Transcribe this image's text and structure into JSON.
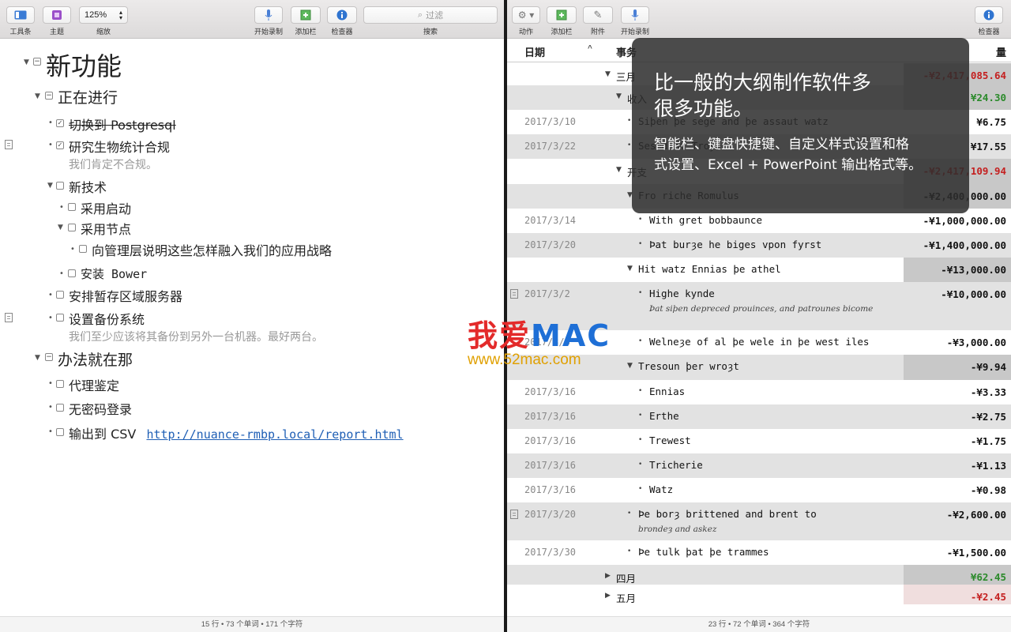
{
  "left_toolbar": {
    "sidebar_label": "工具条",
    "theme_label": "主题",
    "zoom_value": "125%",
    "zoom_label": "缩放",
    "record_label": "开始录制",
    "add_column_label": "添加栏",
    "inspector_label": "检查器",
    "search_placeholder": "过滤",
    "search_label": "搜索"
  },
  "right_toolbar": {
    "action_label": "动作",
    "add_column_label": "添加栏",
    "attachment_label": "附件",
    "record_label": "开始录制",
    "inspector_label": "检查器"
  },
  "outline": {
    "title": "新功能",
    "section1": "正在进行",
    "item1": "切换到 Postgresql",
    "item2": "研究生物统计合规",
    "item2_note": "我们肯定不合规。",
    "item3": "新技术",
    "item3a": "采用启动",
    "item3b": "采用节点",
    "item3b1": "向管理层说明这些怎样融入我们的应用战略",
    "item3c": "安装 Bower",
    "item4": "安排暂存区域服务器",
    "item5": "设置备份系统",
    "item5_note": "我们至少应该将其备份到另外一台机器。最好两台。",
    "section2": "办法就在那",
    "item6": "代理鉴定",
    "item7": "无密码登录",
    "item8_text": "输出到 CSV",
    "item8_link": "http://nuance-rmbp.local/report.html"
  },
  "left_status": "15 行 • 73 个单词 • 171 个字符",
  "table": {
    "col_date": "日期",
    "col_event": "事务",
    "col_amount": "量",
    "rows": [
      {
        "date": "",
        "event": "三月",
        "amount": "-¥2,417,085.64"
      },
      {
        "date": "",
        "event": "收入",
        "amount": "¥24.30"
      },
      {
        "date": "2017/3/10",
        "event": "Siþen þe sege and þe assaut watz",
        "amount": "¥6.75"
      },
      {
        "date": "2017/3/22",
        "event": "Sesed at Troye",
        "amount": "¥17.55"
      },
      {
        "date": "",
        "event": "开支",
        "amount": "-¥2,417,109.94"
      },
      {
        "date": "",
        "event": "Fro riche Romulus",
        "amount": "-¥2,400,000.00"
      },
      {
        "date": "2017/3/14",
        "event": "With gret bobbaunce",
        "amount": "-¥1,000,000.00"
      },
      {
        "date": "2017/3/20",
        "event": "Þat burȝe he biges vpon fyrst",
        "amount": "-¥1,400,000.00"
      },
      {
        "date": "",
        "event": "Hit watz Ennias þe athel",
        "amount": "-¥13,000.00"
      },
      {
        "date": "2017/3/2",
        "event": "Highe kynde",
        "note": "Þat siþen depreced prouinces, and patrounes bicome",
        "amount": "-¥10,000.00"
      },
      {
        "date": "2017/3/3",
        "event": "Welneȝe of al þe wele in þe west iles",
        "amount": "-¥3,000.00"
      },
      {
        "date": "",
        "event": "Tresoun þer wroȝt",
        "amount": "-¥9.94"
      },
      {
        "date": "2017/3/16",
        "event": "Ennias",
        "amount": "-¥3.33"
      },
      {
        "date": "2017/3/16",
        "event": "Erthe",
        "amount": "-¥2.75"
      },
      {
        "date": "2017/3/16",
        "event": "Trewest",
        "amount": "-¥1.75"
      },
      {
        "date": "2017/3/16",
        "event": "Tricherie",
        "amount": "-¥1.13"
      },
      {
        "date": "2017/3/16",
        "event": "Watz",
        "amount": "-¥0.98"
      },
      {
        "date": "2017/3/20",
        "event": "Þe borȝ brittened and brent to",
        "note": "brondeȝ and askez",
        "amount": "-¥2,600.00"
      },
      {
        "date": "2017/3/30",
        "event": "Þe tulk þat þe trammes",
        "amount": "-¥1,500.00"
      },
      {
        "date": "",
        "event": "四月",
        "amount": "¥62.45"
      },
      {
        "date": "",
        "event": "五月",
        "amount": "-¥2.45"
      }
    ]
  },
  "right_status": "23 行 • 72 个单词 • 364 个字符",
  "overlay": {
    "headline_line1": "比一般的大纲制作软件多",
    "headline_line2": "很多功能。",
    "body_line1": "智能栏、键盘快捷键、自定义样式设置和格",
    "body_line2": "式设置、Excel + PowerPoint 输出格式等。"
  },
  "watermark": {
    "brand_cn": "我爱",
    "brand_en": "MAC",
    "url": "www.52mac.com"
  },
  "colors": {
    "negative_red": "#c42020",
    "positive_green": "#2a8a2a",
    "link_blue": "#1f5fb5"
  }
}
